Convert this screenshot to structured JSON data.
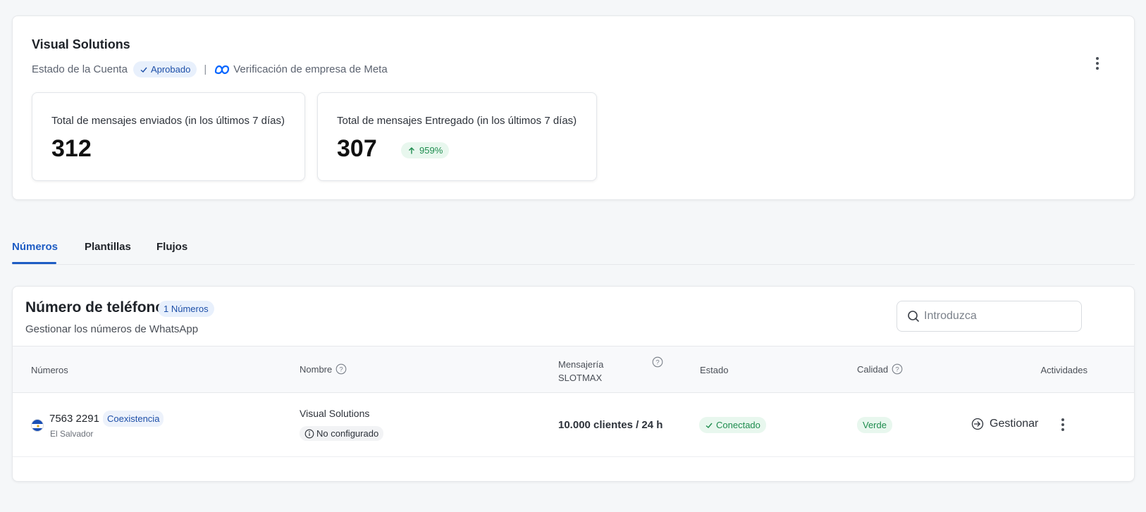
{
  "account": {
    "name": "Visual Solutions",
    "status_label": "Estado de la Cuenta",
    "status_badge": "Aprobado",
    "separator": "|",
    "meta_verification": "Verificación de empresa de Meta"
  },
  "stats": {
    "sent": {
      "label": "Total de mensajes enviados (in los últimos 7 días)",
      "value": "312"
    },
    "delivered": {
      "label": "Total de mensajes Entregado (in los últimos 7 días)",
      "value": "307",
      "trend": "959%"
    }
  },
  "tabs": [
    {
      "label": "Números",
      "active": true
    },
    {
      "label": "Plantillas",
      "active": false
    },
    {
      "label": "Flujos",
      "active": false
    }
  ],
  "phone_section": {
    "title": "Número de teléfono",
    "count_badge": "1 Números",
    "subtitle": "Gestionar los números de WhatsApp",
    "search_placeholder": "Introduzca",
    "columns": {
      "numbers": "Números",
      "name": "Nombre",
      "messaging_1": "Mensajería",
      "messaging_2": "SLOTMAX",
      "status": "Estado",
      "quality": "Calidad",
      "activities": "Actividades"
    },
    "rows": [
      {
        "number": "7563 2291",
        "country": "El Salvador",
        "type_badge": "Coexistencia",
        "name": "Visual Solutions",
        "config_badge": "No configurado",
        "messaging": "10.000 clientes / 24 h",
        "status": "Conectado",
        "quality": "Verde",
        "action": "Gestionar"
      }
    ]
  },
  "colors": {
    "accent": "#1d5cc4",
    "success": "#1e8c4e",
    "success_bg": "#e8f7ee",
    "info_bg": "#e8f0fc"
  },
  "icons": {
    "status_badge": "check-icon",
    "meta": "meta-logo-icon",
    "trend": "arrow-up-icon",
    "search": "search-icon",
    "help": "question-circle-icon",
    "info": "info-circle-icon",
    "manage": "sign-in-icon",
    "more": "vertical-dots-icon",
    "flag": "el-salvador-flag-icon"
  }
}
